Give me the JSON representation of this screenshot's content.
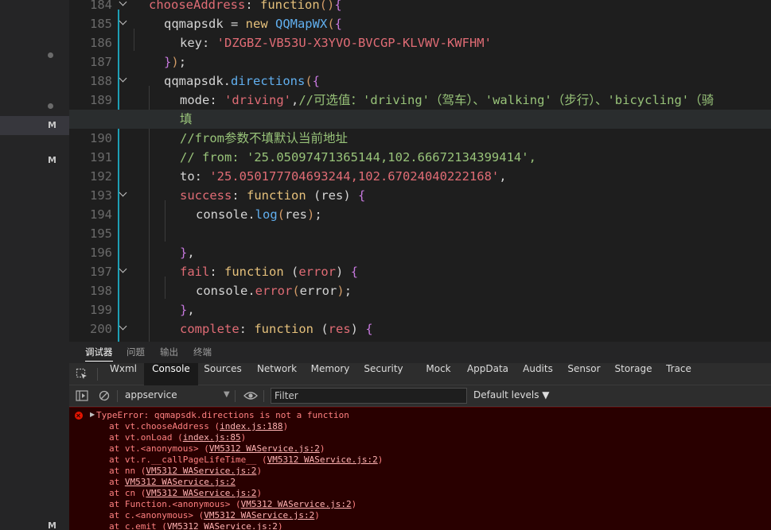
{
  "sidebar": {
    "markers": [
      {
        "type": "dot"
      },
      {
        "type": "dot"
      },
      {
        "type": "M",
        "label": "M"
      },
      {
        "type": "M",
        "label": "M"
      },
      {
        "type": "M",
        "label": "M"
      }
    ]
  },
  "editor": {
    "lines": [
      {
        "n": "184",
        "fold": true,
        "tokens": [
          [
            "kw-prop",
            "chooseAddress"
          ],
          [
            "kw-plain",
            ": "
          ],
          [
            "kw-yellowfn",
            "function"
          ],
          [
            "kw-paren",
            "()"
          ],
          [
            "kw-brace",
            "{"
          ]
        ]
      },
      {
        "n": "185",
        "fold": true,
        "tokens": [
          [
            "kw-plain",
            "qqmapsdk = "
          ],
          [
            "kw-yellowfn",
            "new "
          ],
          [
            "kw-cls",
            "QQMapWX"
          ],
          [
            "kw-paren",
            "("
          ],
          [
            "kw-brace",
            "{"
          ]
        ]
      },
      {
        "n": "186",
        "fold": false,
        "tokens": [
          [
            "kw-plain",
            "key: "
          ],
          [
            "kw-str",
            "'DZGBZ-VB53U-X3YVO-BVCGP-KLVWV-KWFHM'"
          ]
        ]
      },
      {
        "n": "187",
        "fold": false,
        "tokens": [
          [
            "kw-brace",
            "}"
          ],
          [
            "kw-paren",
            ")"
          ],
          [
            "kw-plain",
            ";"
          ]
        ]
      },
      {
        "n": "188",
        "fold": true,
        "tokens": [
          [
            "kw-plain",
            "qqmapsdk."
          ],
          [
            "kw-cls",
            "directions"
          ],
          [
            "kw-paren",
            "("
          ],
          [
            "kw-brace",
            "{"
          ]
        ]
      },
      {
        "n": "189",
        "fold": false,
        "tokens": [
          [
            "kw-plain",
            "mode: "
          ],
          [
            "kw-str",
            "'driving'"
          ],
          [
            "kw-plain",
            ","
          ],
          [
            "kw-cm",
            "//可选值：'driving'（驾车）、'walking'（步行）、'bicycling'（骑"
          ]
        ]
      },
      {
        "n": "",
        "fold": false,
        "tokens": [
          [
            "kw-cm",
            "填"
          ]
        ]
      },
      {
        "n": "190",
        "fold": false,
        "tokens": [
          [
            "kw-cm",
            "//from参数不填默认当前地址"
          ]
        ]
      },
      {
        "n": "191",
        "fold": false,
        "tokens": [
          [
            "kw-cm",
            "// from: '25.05097471365144,102.66672134399414',"
          ]
        ]
      },
      {
        "n": "192",
        "fold": false,
        "tokens": [
          [
            "kw-plain",
            "to: "
          ],
          [
            "kw-str",
            "'25.050177704693244,102.67024040222168'"
          ],
          [
            "kw-plain",
            ","
          ]
        ]
      },
      {
        "n": "193",
        "fold": true,
        "tokens": [
          [
            "kw-prop",
            "success"
          ],
          [
            "kw-plain",
            ": "
          ],
          [
            "kw-yellowfn",
            "function "
          ],
          [
            "kw-plain",
            "(res) "
          ],
          [
            "kw-brace",
            "{"
          ]
        ]
      },
      {
        "n": "194",
        "fold": false,
        "tokens": [
          [
            "kw-plain",
            "console."
          ],
          [
            "kw-cls",
            "log"
          ],
          [
            "kw-paren",
            "("
          ],
          [
            "kw-plain",
            "res"
          ],
          [
            "kw-paren",
            ")"
          ],
          [
            "kw-plain",
            ";"
          ]
        ]
      },
      {
        "n": "195",
        "fold": false,
        "tokens": []
      },
      {
        "n": "196",
        "fold": false,
        "tokens": [
          [
            "kw-brace",
            "}"
          ],
          [
            "kw-plain",
            ","
          ]
        ]
      },
      {
        "n": "197",
        "fold": true,
        "tokens": [
          [
            "kw-prop",
            "fail"
          ],
          [
            "kw-plain",
            ": "
          ],
          [
            "kw-yellowfn",
            "function "
          ],
          [
            "kw-plain",
            "("
          ],
          [
            "kw-prop",
            "error"
          ],
          [
            "kw-plain",
            ") "
          ],
          [
            "kw-brace",
            "{"
          ]
        ]
      },
      {
        "n": "198",
        "fold": false,
        "tokens": [
          [
            "kw-plain",
            "console."
          ],
          [
            "kw-prop",
            "error"
          ],
          [
            "kw-paren",
            "("
          ],
          [
            "kw-plain",
            "error"
          ],
          [
            "kw-paren",
            ")"
          ],
          [
            "kw-plain",
            ";"
          ]
        ]
      },
      {
        "n": "199",
        "fold": false,
        "tokens": [
          [
            "kw-brace",
            "}"
          ],
          [
            "kw-plain",
            ","
          ]
        ]
      },
      {
        "n": "200",
        "fold": true,
        "tokens": [
          [
            "kw-prop",
            "complete"
          ],
          [
            "kw-plain",
            ": "
          ],
          [
            "kw-yellowfn",
            "function "
          ],
          [
            "kw-plain",
            "("
          ],
          [
            "kw-prop",
            "res"
          ],
          [
            "kw-plain",
            ") "
          ],
          [
            "kw-brace",
            "{"
          ]
        ]
      }
    ]
  },
  "panel_tabs": [
    "调试器",
    "问题",
    "输出",
    "终端"
  ],
  "dev_tabs": [
    "Wxml",
    "Console",
    "Sources",
    "Network",
    "Memory",
    "Security",
    "Mock",
    "AppData",
    "Audits",
    "Sensor",
    "Storage",
    "Trace"
  ],
  "console_bar": {
    "context": "appservice",
    "filter_placeholder": "Filter",
    "levels": "Default levels ▼"
  },
  "console_output": {
    "error_message": "TypeError: qqmapsdk.directions is not a function",
    "stack": [
      {
        "pre": "at vt.chooseAddress (",
        "link": "index.js:188",
        "post": ")"
      },
      {
        "pre": "at vt.onLoad (",
        "link": "index.js:85",
        "post": ")"
      },
      {
        "pre": "at vt.<anonymous> (",
        "link": "VM5312 WAService.js:2",
        "post": ")"
      },
      {
        "pre": "at vt.r.__callPageLifeTime__ (",
        "link": "VM5312 WAService.js:2",
        "post": ")"
      },
      {
        "pre": "at nn (",
        "link": "VM5312 WAService.js:2",
        "post": ")"
      },
      {
        "pre": "at ",
        "link": "VM5312 WAService.js:2",
        "post": ""
      },
      {
        "pre": "at cn (",
        "link": "VM5312 WAService.js:2",
        "post": ")"
      },
      {
        "pre": "at Function.<anonymous> (",
        "link": "VM5312 WAService.js:2",
        "post": ")"
      },
      {
        "pre": "at c.<anonymous> (",
        "link": "VM5312 WAService.js:2",
        "post": ")"
      },
      {
        "pre": "at c.emit (",
        "link": "VM5312 WAService.js:2",
        "post": ")"
      }
    ]
  },
  "colors": {
    "accent": "#1d9fb5",
    "error_bg": "#290000",
    "error_text": "#ff8080"
  }
}
